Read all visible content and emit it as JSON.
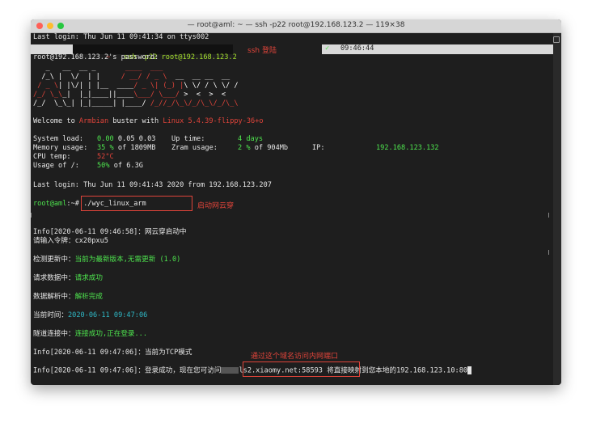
{
  "window": {
    "title": "— root@aml: ~ — ssh -p22 root@192.168.123.2 — 119×38"
  },
  "terminal": {
    "last_login_top": "Last login: Thu Jun 11 09:41:34 on ttys002",
    "prompt_tilde": "~",
    "ssh_command": "ssh -p22 root@192.168.123.2",
    "ssh_annotation": "ssh 登陆",
    "prompt_time": "09:46:44",
    "password_prompt": "root@192.168.123.2's password:",
    "ascii_art": [
      "   _   __  __ _        ____  ___",
      "  /_\\ |  \\/  | |      / __/ / _ \\",
      " / _ \\| |\\/| | |__   / _ \\ | (_) |",
      "/_/ \\_\\_|  |_|____|  \\___/  \\___/ ",
      "/_/  \\_\\_| |_|_____|  |____/  /_//_/\\_\\/_/\\_\\/_/\\_\\"
    ],
    "welcome_prefix": "Welcome to ",
    "welcome_distro": "Armbian",
    "welcome_mid": " buster with ",
    "welcome_kernel": "Linux 5.4.39-flippy-36+o",
    "sys_load_label": "System load:",
    "sys_load_1": "0.00",
    "sys_load_rest": "0.05 0.03",
    "uptime_label": "Up time:",
    "uptime_value": "4 days",
    "mem_label": "Memory usage:",
    "mem_pct": "35 %",
    "mem_of": "of 1809MB",
    "zram_label": "Zram usage:",
    "zram_pct": "2 %",
    "zram_of": "of 904Mb",
    "ip_label": "IP:",
    "ip_value": "192.168.123.132",
    "cpu_label": "CPU temp:",
    "cpu_value": "52°C",
    "usage_label": "Usage of /:",
    "usage_pct": "50%",
    "usage_of": "of 6.3G",
    "last_login_bottom": "Last login: Thu Jun 11 09:41:43 2020 from 192.168.123.207",
    "prompt_user": "root@aml",
    "prompt_sep": ":~# ",
    "run_command": "./wyc_linux_arm",
    "run_annotation": "启动网云穿",
    "info_start_prefix": "Info[2020-06-11 09:46:58]：",
    "info_start_msg": "网云穿启动中",
    "token_line": "请输入令牌：cx20pxu5",
    "check_label": "检测更新中：",
    "check_value": "当前为最新版本,无需更新 (1.0)",
    "req_label": "请求数据中：",
    "req_value": "请求成功",
    "parse_label": "数据解析中：",
    "parse_value": "解析完成",
    "time_label": "当前时间：",
    "time_value": "2020-06-11 09:47:06",
    "tunnel_label": "隧道连接中：",
    "tunnel_value": "连接成功,正在登录...",
    "tcp_line": "Info[2020-06-11 09:47:06]：当前为TCP模式",
    "final_prefix": "Info[2020-06-11 09:47:06]：登录成功，现在您可访问",
    "final_url": "ls2.xiaomy.net:58593",
    "final_suffix": " 将直接映射到您本地的192.168.123.10:80",
    "final_annotation": "通过这个域名访问内网端口"
  },
  "colors": {
    "background": "#1e1e1e",
    "green": "#4ee44e",
    "red": "#e0443a",
    "cyan": "#2fb8c6"
  }
}
